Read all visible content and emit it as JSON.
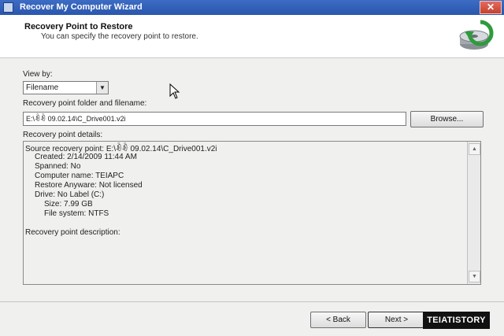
{
  "window": {
    "title": "Recover My Computer Wizard",
    "close_label": "✕"
  },
  "header": {
    "title": "Recovery Point to Restore",
    "subtitle": "You can specify the recovery point to restore."
  },
  "view_by": {
    "label": "View by:",
    "selected": "Filename"
  },
  "folder": {
    "label": "Recovery point folder and filename:",
    "value": "E:\\ꀐꀐ 09.02.14\\C_Drive001.v2i",
    "browse_label": "Browse..."
  },
  "details": {
    "label": "Recovery point details:",
    "lines": [
      "Source recovery point:  E:\\ꀐꀐ 09.02.14\\C_Drive001.v2i",
      "Created:  2/14/2009 11:44 AM",
      "Spanned:  No",
      "Computer name:  TEIAPC",
      "Restore Anyware:  Not licensed",
      "Drive:  No Label (C:)",
      "Size:  7.99 GB",
      "File system:  NTFS",
      "Recovery point description:"
    ]
  },
  "footer": {
    "back_label": "< Back",
    "next_label": "Next >"
  },
  "watermark": "TEIATISTORY"
}
